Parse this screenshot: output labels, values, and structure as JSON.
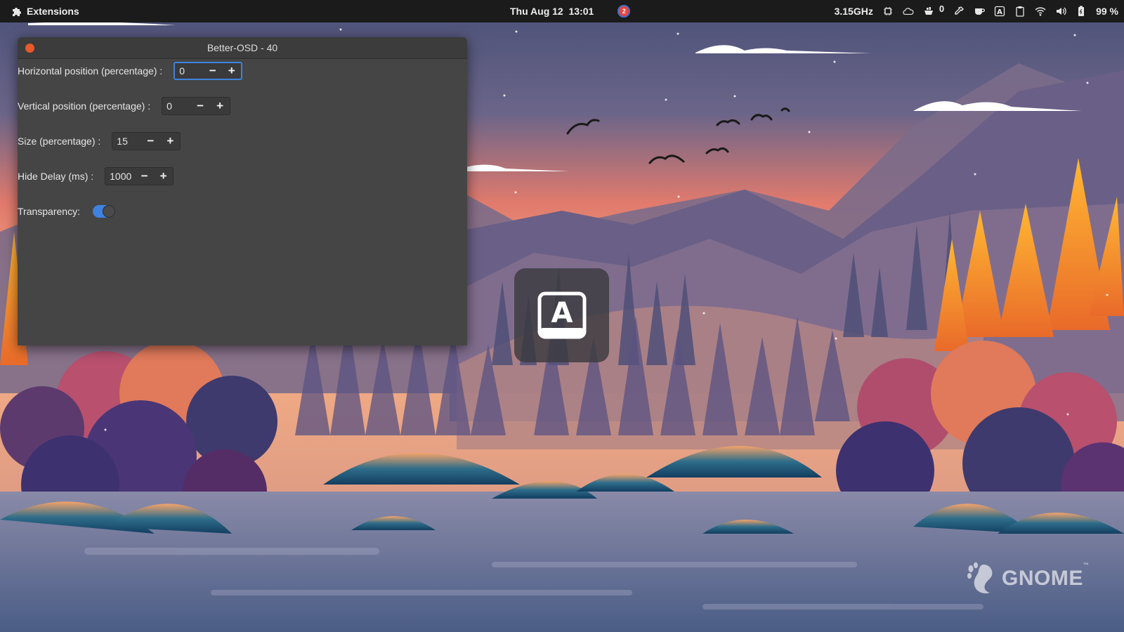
{
  "topbar": {
    "activities_label": "Extensions",
    "date_time": "Thu Aug 12  13:01",
    "notification_count": "2",
    "cpu_freq": "3.15GHz",
    "updates_count": "0",
    "battery_percent": "99 %"
  },
  "window": {
    "title": "Better-OSD - 40",
    "fields": {
      "horizontal": {
        "label": "Horizontal position (percentage) :",
        "value": "0"
      },
      "vertical": {
        "label": "Vertical position (percentage) :",
        "value": "0"
      },
      "size": {
        "label": "Size (percentage) :",
        "value": "15"
      },
      "hide_delay": {
        "label": "Hide Delay (ms) :",
        "value": "1000"
      },
      "transparency": {
        "label": "Transparency:",
        "enabled": true
      }
    },
    "minus_glyph": "−",
    "plus_glyph": "+"
  },
  "osd": {
    "letter": "A",
    "icon": "keyboard-layout-icon"
  },
  "wallpaper": {
    "logo_text": "GNOME",
    "trademark": "™"
  },
  "colors": {
    "accent": "#3d82e0",
    "close": "#e8592b",
    "window_bg": "#454545",
    "topbar_bg": "#1b1b1b"
  }
}
